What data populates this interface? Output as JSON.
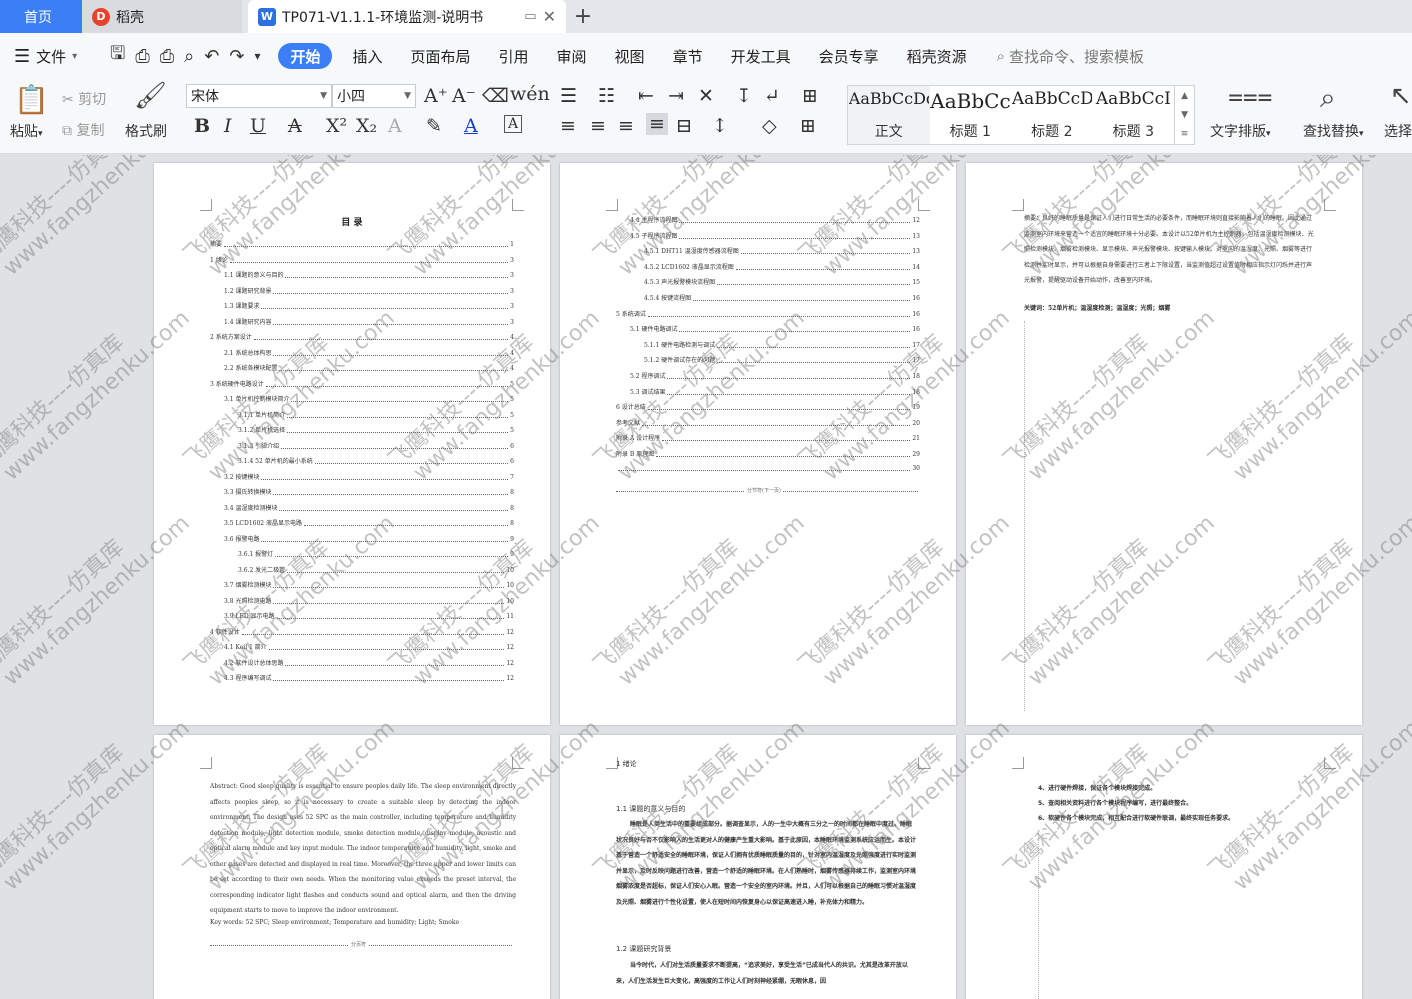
{
  "tabs": {
    "home": "首页",
    "daoke": "稻壳",
    "document": "TP071-V1.1.1-环境监测-说明书",
    "add": "+"
  },
  "menu": {
    "file": "文件",
    "items": [
      "开始",
      "插入",
      "页面布局",
      "引用",
      "审阅",
      "视图",
      "章节",
      "开发工具",
      "会员专享",
      "稻壳资源"
    ],
    "search": "查找命令、搜索模板"
  },
  "ribbon": {
    "paste": "粘贴",
    "cut": "剪切",
    "copy": "复制",
    "format_painter": "格式刷",
    "font_name": "宋体",
    "font_size": "小四",
    "styles": [
      {
        "sample": "AaBbCcDd",
        "name": "正文"
      },
      {
        "sample": "AaBbCc",
        "name": "标题 1"
      },
      {
        "sample": "AaBbCcD",
        "name": "标题 2"
      },
      {
        "sample": "AaBbCcI",
        "name": "标题 3"
      }
    ],
    "text_layout": "文字排版",
    "find_replace": "查找替换",
    "select": "选择"
  },
  "toc_page1": {
    "title": "目  录",
    "rows": [
      {
        "t": "摘要",
        "p": "1"
      },
      {
        "t": "1  绪论",
        "p": "3"
      },
      {
        "t": "1.1 课题的意义与目的",
        "p": "3"
      },
      {
        "t": "1.2 课题研究背景",
        "p": "3"
      },
      {
        "t": "1.3 课题要求",
        "p": "3"
      },
      {
        "t": "1.4 课题研究内容",
        "p": "3"
      },
      {
        "t": "2  系统方案设计",
        "p": "4"
      },
      {
        "t": "2.1 系统总体构思",
        "p": "4"
      },
      {
        "t": "2.2 系统各模块配置",
        "p": "4"
      },
      {
        "t": "3  系统硬件电路设计",
        "p": "5"
      },
      {
        "t": "3.1 单片机控制模块简介",
        "p": "5"
      },
      {
        "t": "3.1.1 单片机简介",
        "p": "5"
      },
      {
        "t": "3.1.2 单片机选择",
        "p": "5"
      },
      {
        "t": "3.1.3 引脚介绍",
        "p": "6"
      },
      {
        "t": "3.1.4 52 单片机的最小系统",
        "p": "6"
      },
      {
        "t": "3.2 按键模块",
        "p": "7"
      },
      {
        "t": "3.3 摄氏转换模块",
        "p": "8"
      },
      {
        "t": "3.4 温湿度检测模块",
        "p": "8"
      },
      {
        "t": "3.5 LCD1602 液晶显示电路",
        "p": "8"
      },
      {
        "t": "3.6 报警电路",
        "p": "9"
      },
      {
        "t": "3.6.1 报警灯",
        "p": "9"
      },
      {
        "t": "3.6.2 发光二极管",
        "p": "10"
      },
      {
        "t": "3.7 烟雾检测模块",
        "p": "10"
      },
      {
        "t": "3.8 光照检测电路",
        "p": "10"
      },
      {
        "t": "3.9 LED 显示电路",
        "p": "11"
      },
      {
        "t": "4  软件设计",
        "p": "12"
      },
      {
        "t": "4.1 Keil 1 简介",
        "p": "12"
      },
      {
        "t": "4.2 软件设计总体思路",
        "p": "12"
      },
      {
        "t": "4.3 程序编写调试",
        "p": "12"
      }
    ]
  },
  "toc_page2": {
    "rows": [
      {
        "t": "4.4 主程序流程图",
        "p": "12"
      },
      {
        "t": "4.5 子程序流程图",
        "p": "13"
      },
      {
        "t": "4.5.1 DHT11 温湿度传感器流程图",
        "p": "13"
      },
      {
        "t": "4.5.2 LCD1602 液晶显示流程图",
        "p": "14"
      },
      {
        "t": "4.5.3 声光报警模块流程图",
        "p": "15"
      },
      {
        "t": "4.5.4 按键流程图",
        "p": "16"
      },
      {
        "t": "5  系统调试",
        "p": "16"
      },
      {
        "t": "5.1 硬件电路调试",
        "p": "16"
      },
      {
        "t": "5.1.1 硬件电路检测与调试",
        "p": "17"
      },
      {
        "t": "5.1.2 硬件调试存在的问题",
        "p": "17"
      },
      {
        "t": "5.2 程序调试",
        "p": "18"
      },
      {
        "t": "5.3 调试结果",
        "p": "18"
      },
      {
        "t": "6  设计总结",
        "p": "19"
      },
      {
        "t": "参考文献",
        "p": "20"
      },
      {
        "t": "附录 A 设计程序",
        "p": "21"
      },
      {
        "t": "附录 B 原理图",
        "p": "29"
      },
      {
        "t": "",
        "p": "30"
      }
    ],
    "break": "分节符(下一页)"
  },
  "abstract_cn": {
    "text": "摘要：良好的睡眠质量是保证人们进行日常生活的必要条件，而睡眠环境则直接影响着人们的睡眠。因此通过监测室内环境来营造一个适宜的睡眠环境十分必要。本设计以52单片机为主控制器，包括温湿度检测模块、光照检测模块、烟雾检测模块、显示模块、声光报警模块、按键输入模块。对室内的温湿度、光照、烟雾等进行检测并实时显示，并可以根据自身需要进行三者上下限设置，当监测值超过设置值时相应指示灯闪烁并进行声光报警，提醒驱动设备开始动作，改善室内环境。",
    "keywords": "关键词：52单片机；温湿度检测；温湿度；光照；烟雾"
  },
  "abstract_en": {
    "text": "Abstract: Good sleep quality is essential to ensure peoples daily life. The sleep environment directly affects peoples sleep, so it is necessary to create a suitable sleep by detecting the indoor environment. The design uses 52 SPC as the main controller, including temperature and humidity detection module, light detection module, smoke detection module, display module, acoustic and optical alarm module and key input module. The indoor temperature and humidity, light, smoke and other gases are detected and displayed in real time. Moreover, the three upper and lower limits can be set according to their own needs. When the monitoring value exceeds the preset interval, the corresponding indicator light flashes and conducts sound and optical alarm, and then the driving equipment starts to move to improve the indoor environment.",
    "keywords": "Key words: 52 SPC; Sleep environment; Temperature and humidity; Light; Smoke",
    "break": "分页符"
  },
  "intro": {
    "chapter": "1  绪论",
    "section1": "1.1 课题的意义与目的",
    "para1": "睡眠是人类生活中的重要组成部分。据调查显示，人的一生中大概有三分之一的时间都在睡眠中度过。睡眠状况良好与否不仅影响人的生活更对人的健康产生重大影响。基于此原因，本睡眠环境监测系统应运而生。本设计基于营造一个舒适安全的睡眠环境，保证人们拥有优质睡眠质量的目的，针对室内温湿度及光照强度进行实时监测并显示，及时反映问题进行改善，营造一个舒适的睡眠环境。在人们熟睡时，烟雾传感器持续工作，监测室内环境烟雾浓度是否超标，保证人们安心入眠。营造一个安全的室内环境。并且，人们可以根据自己的睡眠习惯对温湿度及光照、烟雾进行个性化设置，使人在短时间内恢复身心以保证高速进入睡，补充体力和精力。",
    "section2": "1.2 课题研究背景",
    "para2": "当今时代，人们对生活质量要求不断提高，“追求美好，享受生活”已成当代人的共识。尤其是改革开放以来，人们生活发生巨大变化，高强度的工作让人们时刻神经紧绷，无暇休息，因"
  },
  "steps": {
    "items": [
      "4、进行硬件焊接，保证各个模块焊接完成。",
      "5、查阅相关资料进行各个模块程序编写，进行最终整合。",
      "6、软硬件各个模块完成，相互配合进行软硬件联调，最终实现任务要求。"
    ]
  },
  "watermark": {
    "cn": "飞鹰科技----仿真库",
    "url": "www.fangzhenku.com"
  }
}
